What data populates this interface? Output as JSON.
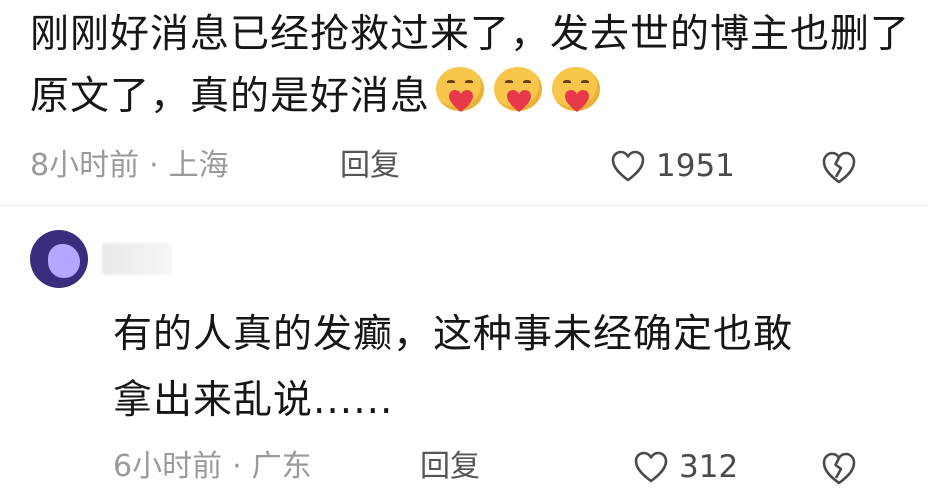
{
  "comment1": {
    "text": "刚刚好消息已经抢救过来了，发去世的博主也删了原文了，真的是好消息",
    "emojis": [
      "heart-face-emoji",
      "heart-face-emoji",
      "heart-face-emoji"
    ],
    "time": "8小时前",
    "location": "上海",
    "reply_label": "回复",
    "like_count": "1951"
  },
  "comment2": {
    "text_line1": "有的人真的发癫，这种事未经确定也敢",
    "text_line2": "拿出来乱说......",
    "time": "6小时前",
    "location": "广东",
    "reply_label": "回复",
    "like_count": "312"
  },
  "separator": "·",
  "colors": {
    "text": "#161616",
    "meta": "#9a9a9a",
    "avatar_bg": "#3b2d7d",
    "avatar_fg": "#b7a6ff",
    "emoji_face": "#f7c64a",
    "emoji_heart": "#e8394a"
  }
}
